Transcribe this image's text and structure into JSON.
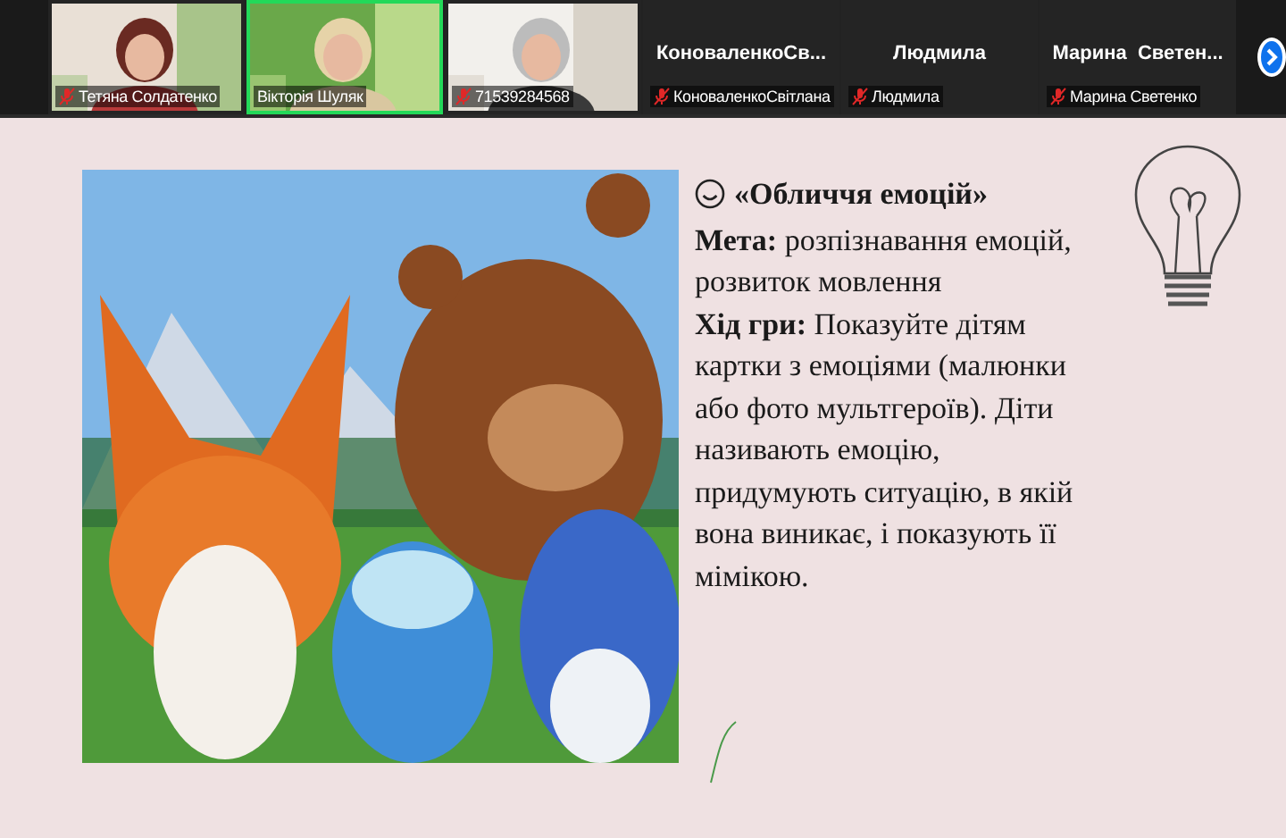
{
  "participants": [
    {
      "kind": "video",
      "label": "Тетяна Солдатенко",
      "muted": true,
      "selected": false
    },
    {
      "kind": "video",
      "label": "Вікторія Шуляк",
      "muted": false,
      "selected": true
    },
    {
      "kind": "video",
      "label": "71539284568",
      "muted": true,
      "selected": false
    },
    {
      "kind": "name",
      "display_name": "КоноваленкоСв...",
      "label": "КоноваленкоСвітлана",
      "muted": true,
      "selected": false
    },
    {
      "kind": "name",
      "display_name": "Людмила",
      "label": "Людмила",
      "muted": true,
      "selected": false
    },
    {
      "kind": "name",
      "display_name": "Марина  Светен...",
      "label": "Марина Светенко",
      "muted": true,
      "selected": false
    }
  ],
  "slide": {
    "title": "«Обличчя емоцій»",
    "paragraphs": [
      "**Мета:** розпізнавання емоцій, розвиток мовлення",
      "**Хід гри:** Показуйте дітям картки з емоціями (малюнки або фото мультгероїв). Діти називають емоцію, придумують ситуацію, в якій вона виникає, і показують її мімікою."
    ]
  }
}
